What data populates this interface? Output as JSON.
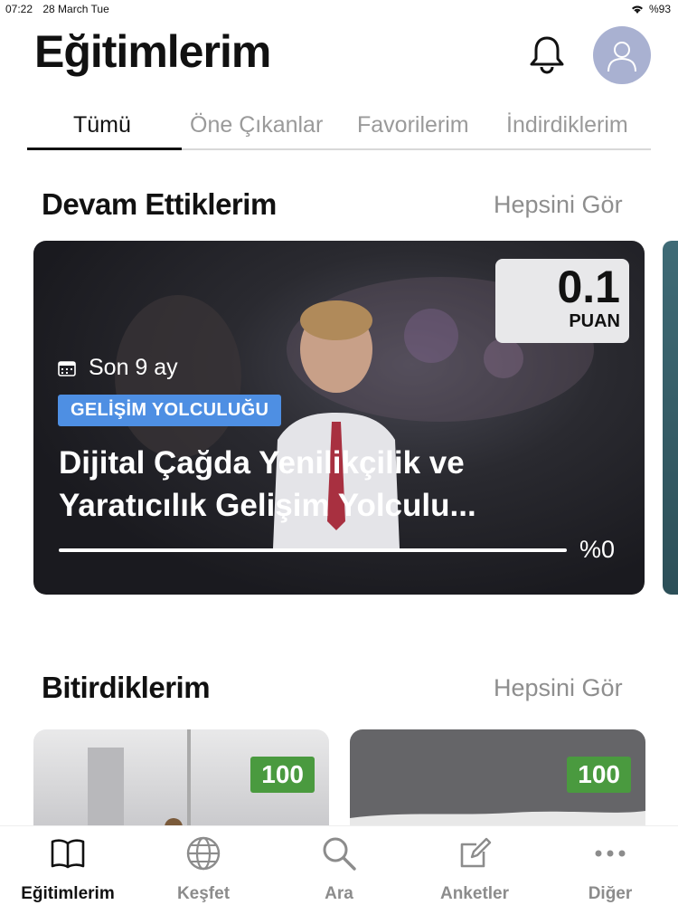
{
  "status_bar": {
    "time": "07:22",
    "date": "28 March Tue",
    "battery": "%93"
  },
  "header": {
    "title": "Eğitimlerim"
  },
  "tabs": [
    {
      "label": "Tümü"
    },
    {
      "label": "Öne Çıkanlar"
    },
    {
      "label": "Favorilerim"
    },
    {
      "label": "İndirdiklerim"
    }
  ],
  "continuing": {
    "title": "Devam Ettiklerim",
    "see_all": "Hepsini Gör",
    "card": {
      "points_value": "0.1",
      "points_label": "PUAN",
      "date": "Son 9 ay",
      "badge": "GELİŞİM YOLCULUĞU",
      "title": "Dijital Çağda Yenilikçilik ve Yaratıcılık Gelişim Yolculu...",
      "progress_label": "%0",
      "progress_fraction": 0
    }
  },
  "completed": {
    "title": "Bitirdiklerim",
    "see_all": "Hepsini Gör",
    "cards": [
      {
        "score": "100"
      },
      {
        "score": "100"
      }
    ]
  },
  "bottom_nav": [
    {
      "label": "Eğitimlerim",
      "icon": "book-icon"
    },
    {
      "label": "Keşfet",
      "icon": "globe-icon"
    },
    {
      "label": "Ara",
      "icon": "search-icon"
    },
    {
      "label": "Anketler",
      "icon": "edit-icon"
    },
    {
      "label": "Diğer",
      "icon": "more-icon"
    }
  ],
  "colors": {
    "badge": "#4e8fe3",
    "score": "#4a9a3f",
    "avatar": "#a9b1d1"
  }
}
